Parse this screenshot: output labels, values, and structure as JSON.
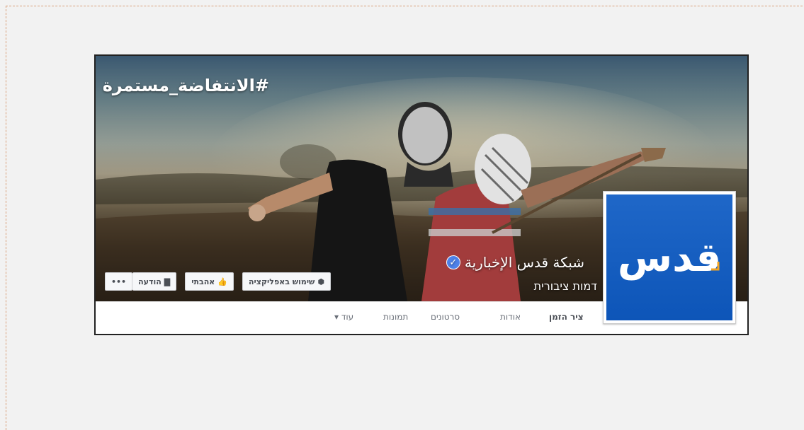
{
  "cover": {
    "hashtag": "#الانتفاضة_مستمرة"
  },
  "page": {
    "name": "شبكة قدس الإخبارية",
    "category": "דמות ציבורית",
    "logo_text": "قدس",
    "verified_icon": "check-icon"
  },
  "actions": {
    "use_app": {
      "label": "שימוש באפליקציה",
      "icon": "cube-icon"
    },
    "like": {
      "label": "אהבתי",
      "icon": "thumbs-up-icon"
    },
    "message": {
      "label": "הודעה",
      "icon": "speech-bubble-icon"
    },
    "more": {
      "label": "•••"
    }
  },
  "tabs": [
    {
      "label": "ציר הזמן",
      "active": true
    },
    {
      "label": "אודות"
    },
    {
      "label": "סרטונים"
    },
    {
      "label": "תמונות"
    },
    {
      "label": "עוד ▾"
    }
  ],
  "colors": {
    "logo_bg": "#1f67c8",
    "verified": "#4e81e8",
    "tab_underline": "#4267b2"
  }
}
